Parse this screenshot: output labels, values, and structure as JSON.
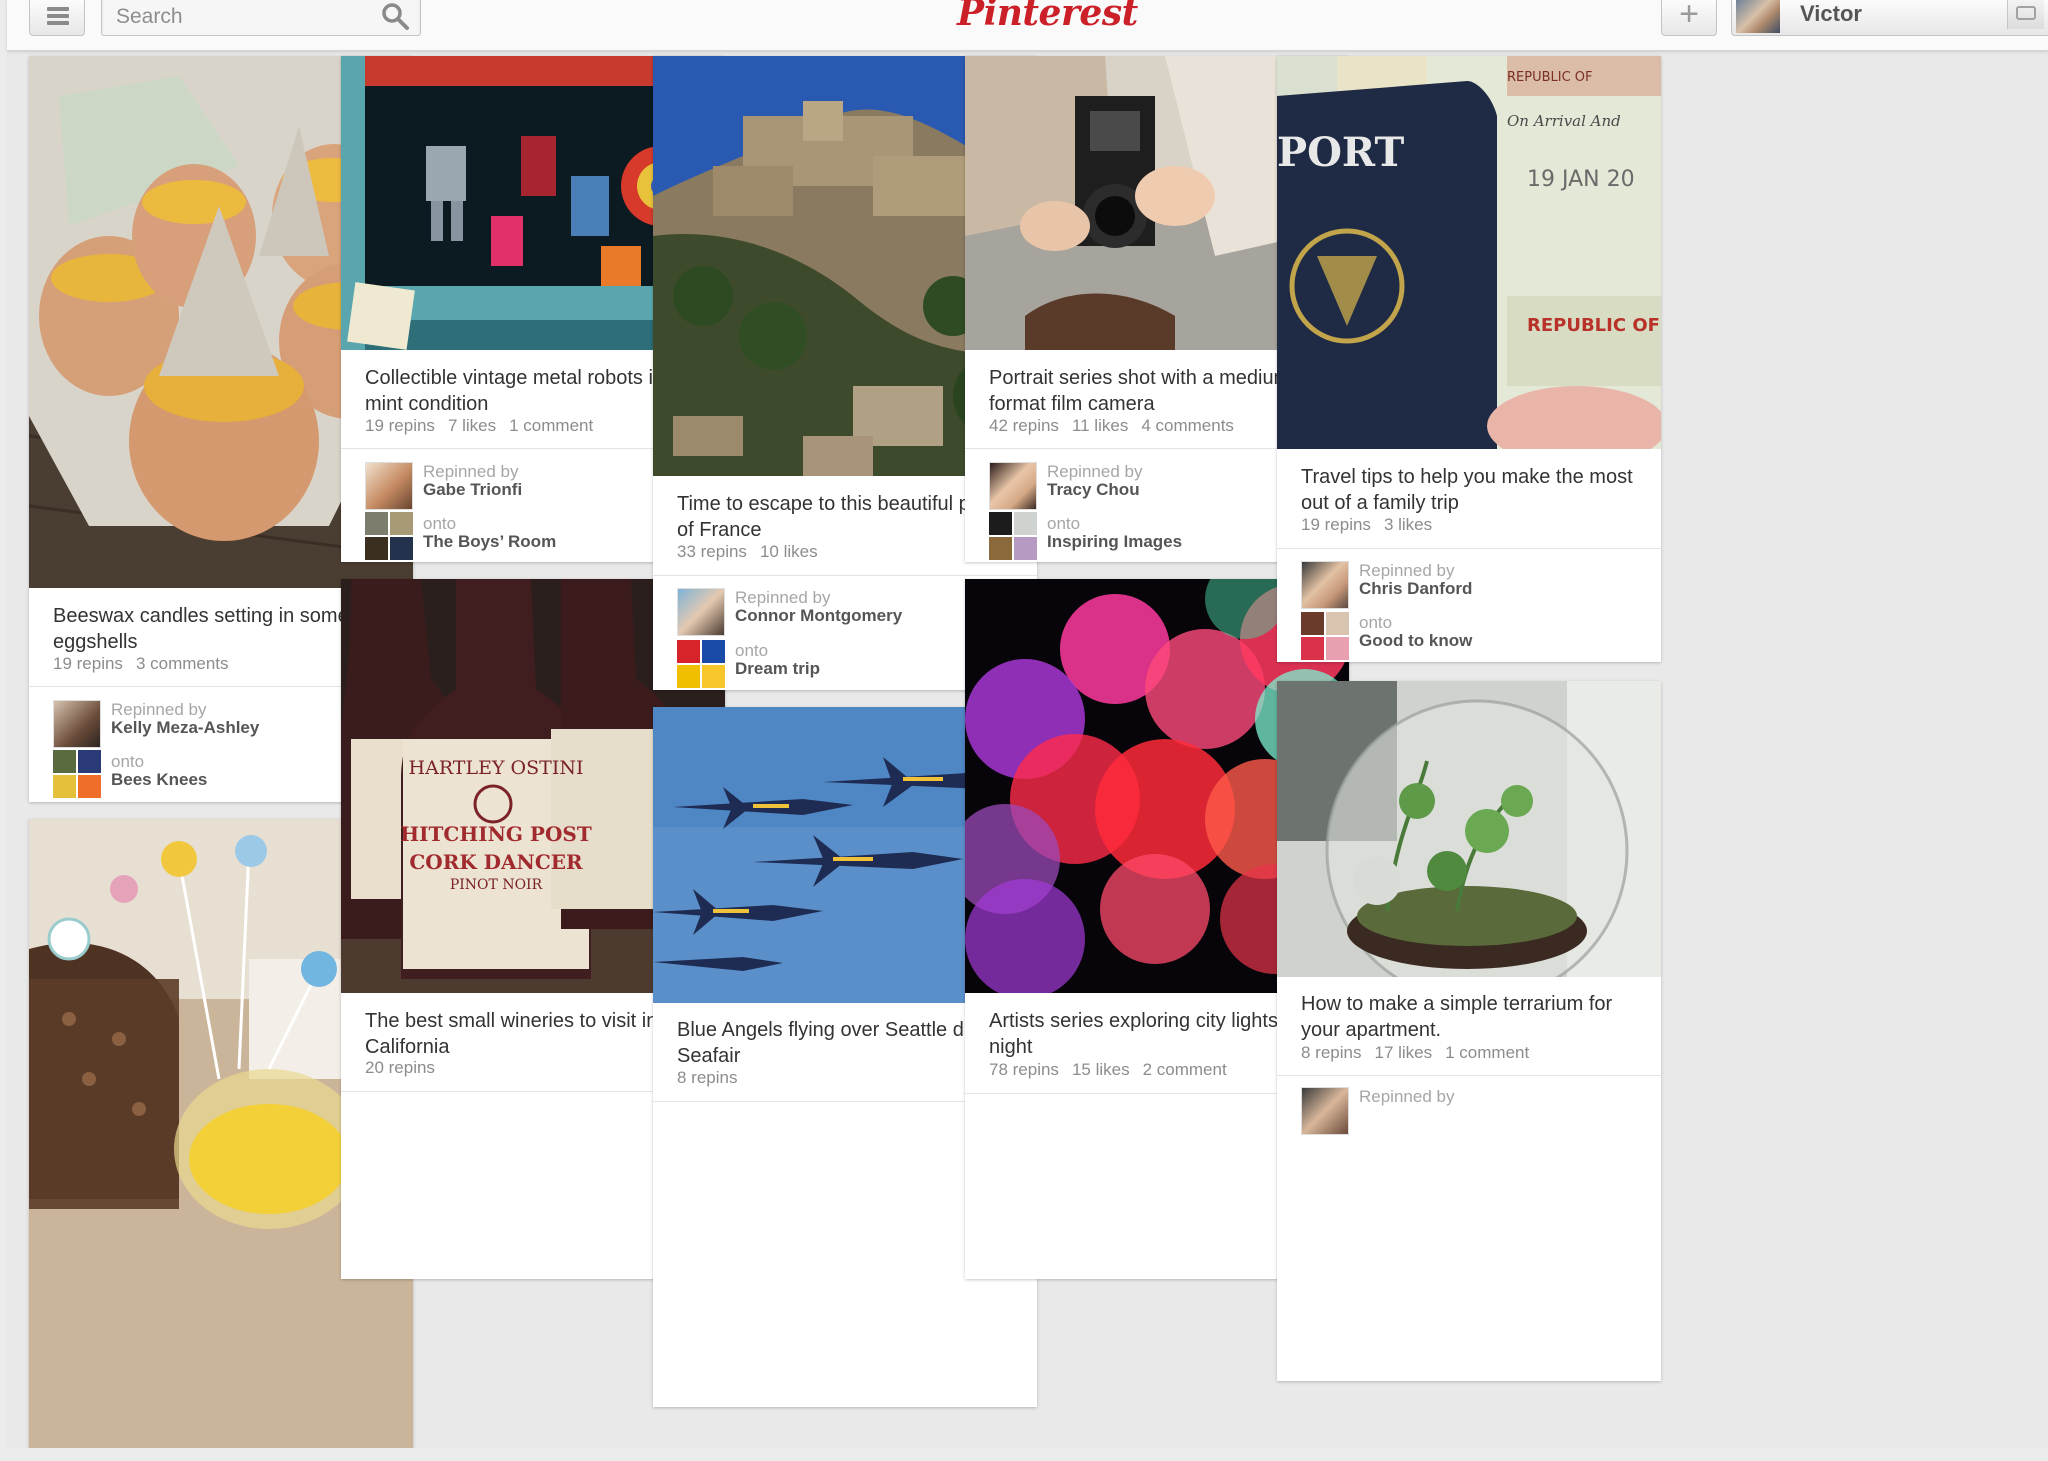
{
  "header": {
    "search_placeholder": "Search",
    "logo": "Pinterest",
    "add_label": "+",
    "user_name": "Victor"
  },
  "pins": [
    {
      "description": "Beeswax candles setting in some eggshells",
      "stats": [
        "19 repins",
        "3 comments"
      ],
      "repinned_label": "Repinned by",
      "repinned_by": "Kelly Meza-Ashley",
      "onto_label": "onto",
      "board": "Bees Knees"
    },
    {
      "description": "Collectible vintage metal robots in mint condition",
      "stats": [
        "19 repins",
        "7 likes",
        "1 comment"
      ],
      "repinned_label": "Repinned by",
      "repinned_by": "Gabe Trionfi",
      "onto_label": "onto",
      "board": "The Boys’ Room"
    },
    {
      "description": "The best small wineries to visit in California",
      "stats": [
        "20 repins"
      ]
    },
    {
      "description": "Time to escape to this beautiful part of France",
      "stats": [
        "33 repins",
        "10 likes"
      ],
      "repinned_label": "Repinned by",
      "repinned_by": "Connor Montgomery",
      "onto_label": "onto",
      "board": "Dream trip"
    },
    {
      "description": "Blue Angels flying over Seattle during Seafair",
      "stats": [
        "8 repins"
      ]
    },
    {
      "description": "Portrait series shot with a medium format film camera",
      "stats": [
        "42 repins",
        "11 likes",
        "4 comments"
      ],
      "repinned_label": "Repinned by",
      "repinned_by": "Tracy Chou",
      "onto_label": "onto",
      "board": "Inspiring Images"
    },
    {
      "description": "Artists series exploring city lights at night",
      "stats": [
        "78 repins",
        "15 likes",
        "2 comment"
      ]
    },
    {
      "description": "Travel tips to help you make the most out of a family trip",
      "stats": [
        "19 repins",
        "3 likes"
      ],
      "repinned_label": "Repinned by",
      "repinned_by": "Chris Danford",
      "onto_label": "onto",
      "board": "Good to know"
    },
    {
      "description": "How to make a simple terrarium for your apartment.",
      "stats": [
        "8 repins",
        "17 likes",
        "1 comment"
      ],
      "repinned_label": "Repinned by"
    }
  ],
  "image_text": {
    "wine_label_1": "HARTLEY OSTINI",
    "wine_label_2": "HITCHING POST",
    "wine_label_3": "CORK DANCER",
    "wine_label_4": "PINOT NOIR",
    "passport_1": "PORT",
    "passport_2": "REPUBLIC OF",
    "passport_3": "On Arrival And",
    "passport_4": "19 JAN 20"
  }
}
